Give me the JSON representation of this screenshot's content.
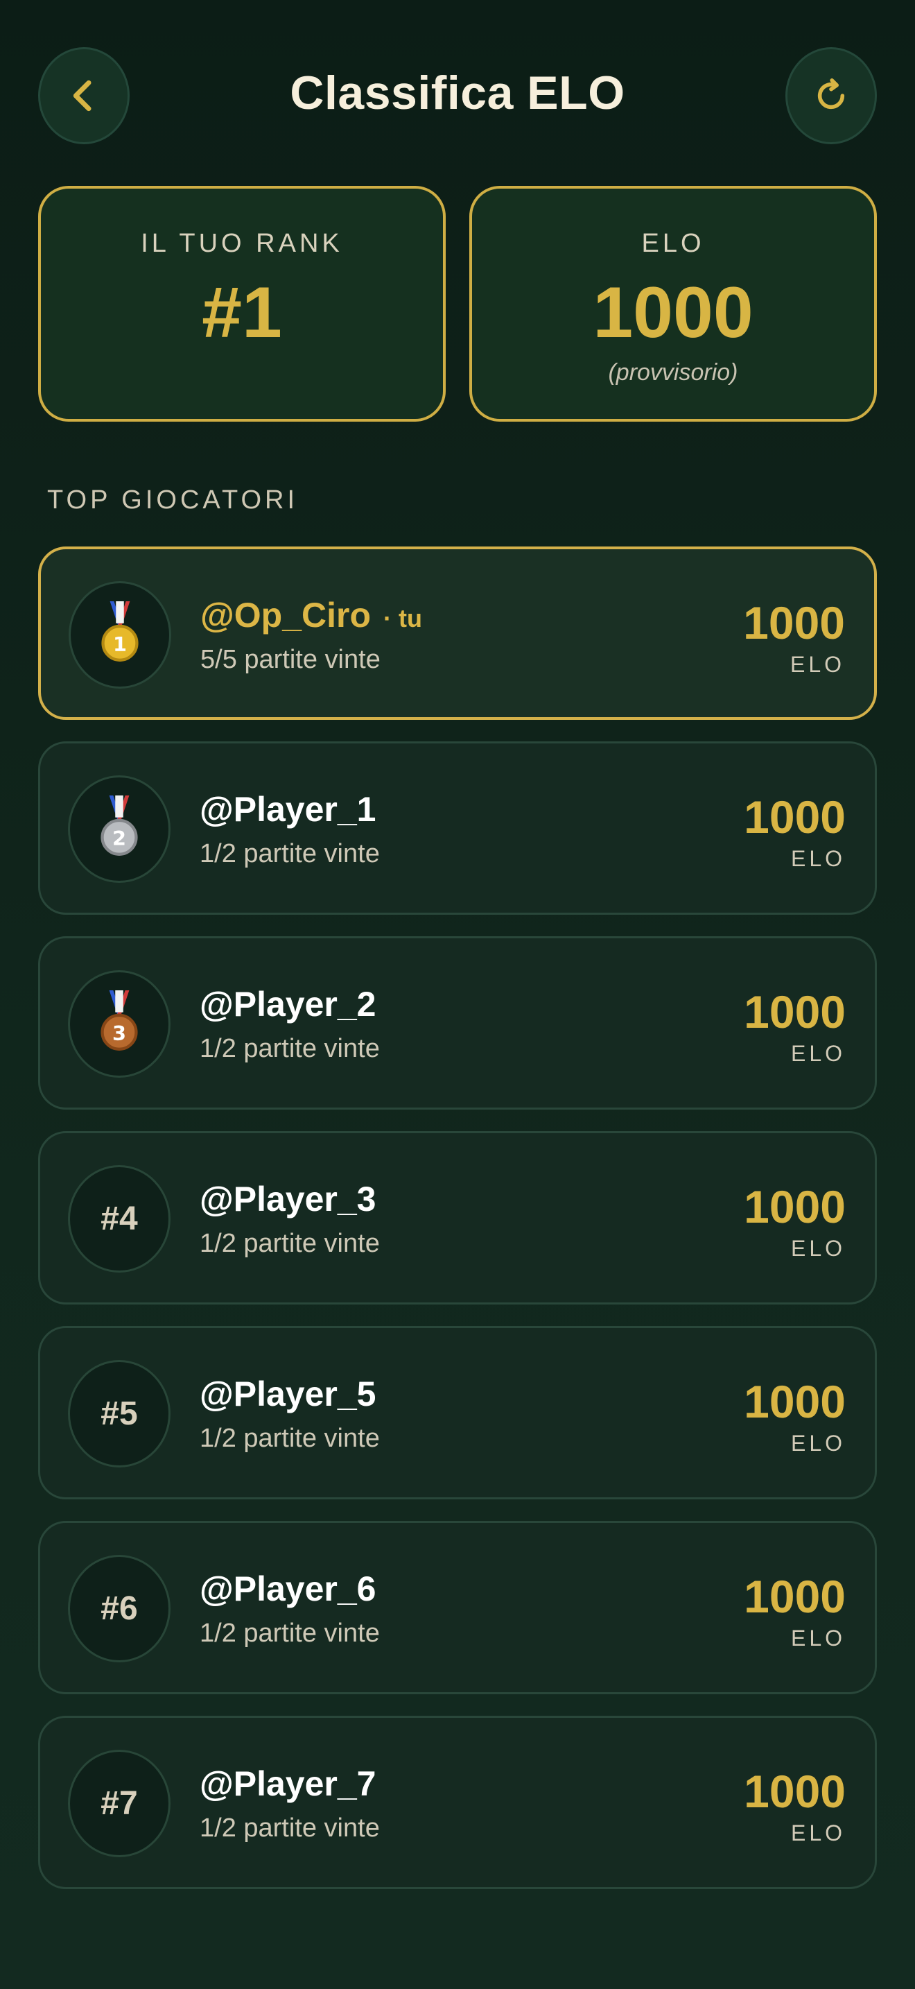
{
  "header": {
    "title": "Classifica ELO",
    "back_icon": "chevron-left-icon",
    "refresh_icon": "refresh-icon"
  },
  "stats": {
    "rank_label": "IL TUO RANK",
    "rank_value": "#1",
    "elo_label": "ELO",
    "elo_value": "1000",
    "elo_note": "(provvisorio)"
  },
  "section": {
    "title": "TOP GIOCATORI"
  },
  "players": [
    {
      "badge": "",
      "medal": "gold",
      "medal_number": "1",
      "name": "@Op_Ciro",
      "tag": "· tu",
      "record": "5/5 partite vinte",
      "elo": "1000",
      "elo_unit": "ELO",
      "is_me": true
    },
    {
      "badge": "",
      "medal": "silver",
      "medal_number": "2",
      "name": "@Player_1",
      "tag": "",
      "record": "1/2 partite vinte",
      "elo": "1000",
      "elo_unit": "ELO",
      "is_me": false
    },
    {
      "badge": "",
      "medal": "bronze",
      "medal_number": "3",
      "name": "@Player_2",
      "tag": "",
      "record": "1/2 partite vinte",
      "elo": "1000",
      "elo_unit": "ELO",
      "is_me": false
    },
    {
      "badge": "#4",
      "medal": "",
      "name": "@Player_3",
      "tag": "",
      "record": "1/2 partite vinte",
      "elo": "1000",
      "elo_unit": "ELO",
      "is_me": false
    },
    {
      "badge": "#5",
      "medal": "",
      "name": "@Player_5",
      "tag": "",
      "record": "1/2 partite vinte",
      "elo": "1000",
      "elo_unit": "ELO",
      "is_me": false
    },
    {
      "badge": "#6",
      "medal": "",
      "name": "@Player_6",
      "tag": "",
      "record": "1/2 partite vinte",
      "elo": "1000",
      "elo_unit": "ELO",
      "is_me": false
    },
    {
      "badge": "#7",
      "medal": "",
      "name": "@Player_7",
      "tag": "",
      "record": "1/2 partite vinte",
      "elo": "1000",
      "elo_unit": "ELO",
      "is_me": false
    }
  ],
  "colors": {
    "accent_gold": "#d8b544",
    "background": "#0c1d16",
    "card": "#152a21"
  }
}
